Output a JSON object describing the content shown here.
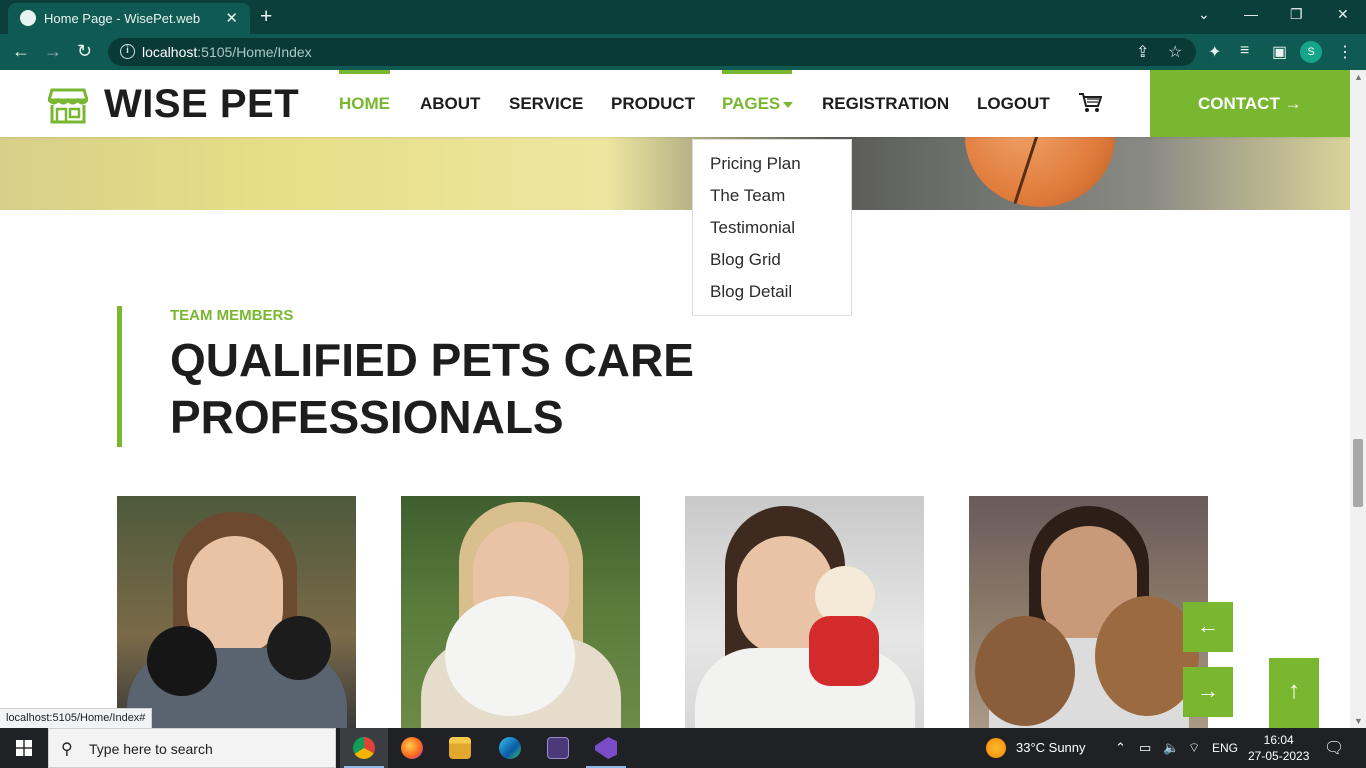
{
  "browser": {
    "tab_title": "Home Page - WisePet.web",
    "url_host": "localhost",
    "url_path": ":5105/Home/Index",
    "profile_initial": "S"
  },
  "site": {
    "brand": "WISE PET",
    "nav": [
      {
        "label": "HOME"
      },
      {
        "label": "ABOUT"
      },
      {
        "label": "SERVICE"
      },
      {
        "label": "PRODUCT"
      },
      {
        "label": "PAGES"
      },
      {
        "label": "REGISTRATION"
      },
      {
        "label": "LOGOUT"
      }
    ],
    "contact_label": "CONTACT →",
    "pages_dropdown": [
      "Pricing Plan",
      "The Team",
      "Testimonial",
      "Blog Grid",
      "Blog Detail"
    ],
    "accent_color": "#7ab730"
  },
  "team_section": {
    "kicker": "TEAM MEMBERS",
    "heading": "QUALIFIED PETS CARE PROFESSIONALS",
    "prev_arrow": "←",
    "next_arrow": "→",
    "back_to_top": "↑"
  },
  "status_url": "localhost:5105/Home/Index#",
  "taskbar": {
    "search_placeholder": "Type here to search",
    "weather": "33°C  Sunny",
    "language": "ENG",
    "time": "16:04",
    "date": "27-05-2023"
  }
}
